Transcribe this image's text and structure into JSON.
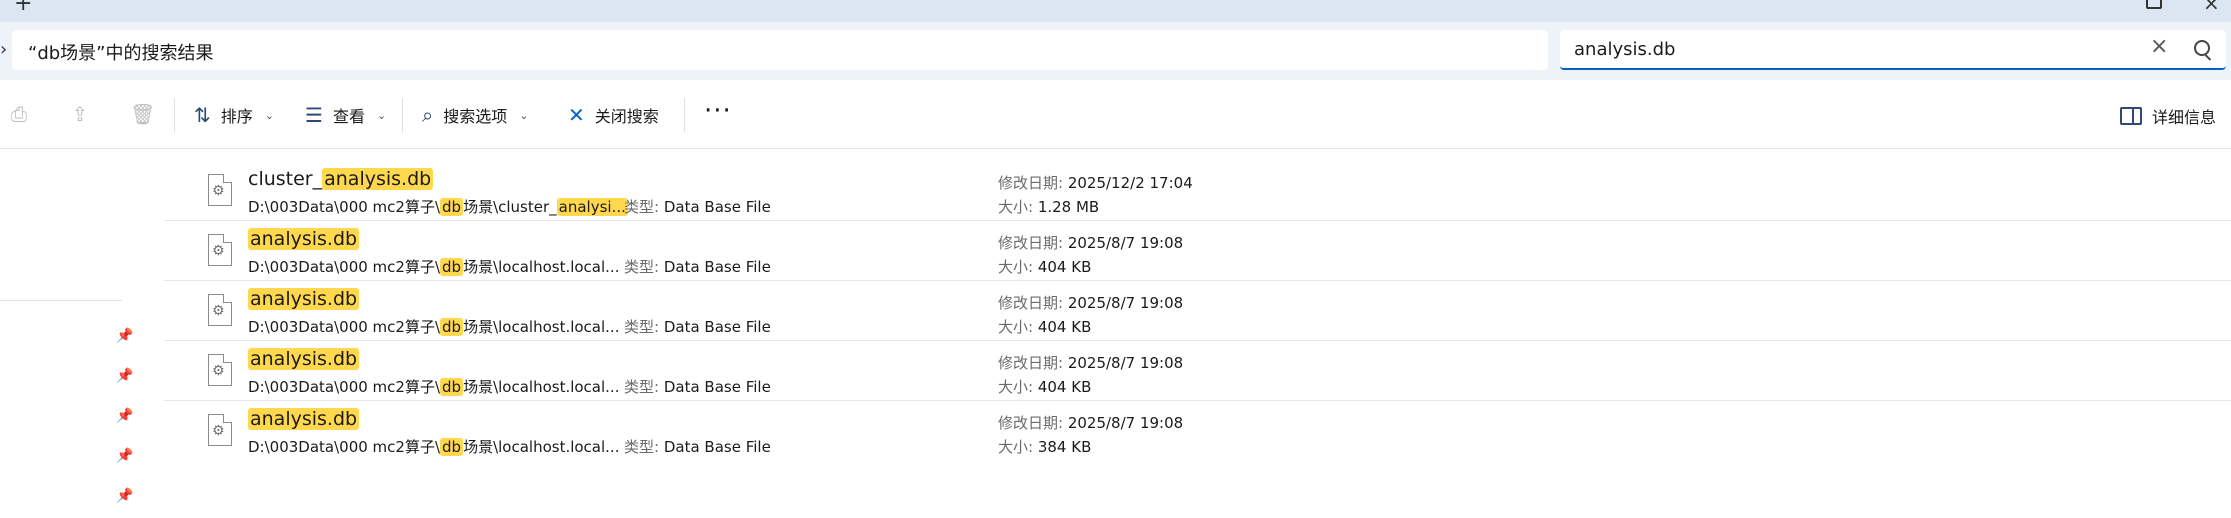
{
  "address": {
    "text": "“db场景”中的搜索结果"
  },
  "search": {
    "value": "analysis.db",
    "clear_icon": "close-icon",
    "search_icon": "search-icon"
  },
  "toolbar": {
    "sort_label": "排序",
    "view_label": "查看",
    "search_options_label": "搜索选项",
    "close_search_label": "关闭搜索",
    "more_label": "···",
    "details_label": "详细信息"
  },
  "labels": {
    "type_key": "类型: ",
    "date_key": "修改日期: ",
    "size_key": "大小: "
  },
  "results": [
    {
      "name_pre": "cluster_",
      "name_hl": "analysis.db",
      "path_pre": "D:\\003Data\\000 mc2算子\\",
      "path_hl": "db",
      "path_mid": "场景\\cluster_",
      "path_hl2": "analysi...",
      "type": "Data Base File",
      "date": "2025/12/2 17:04",
      "size": "1.28 MB"
    },
    {
      "name_pre": "",
      "name_hl": "analysis.db",
      "path_pre": "D:\\003Data\\000 mc2算子\\",
      "path_hl": "db",
      "path_mid": "场景\\localhost.local...",
      "path_hl2": "",
      "type": "Data Base File",
      "date": "2025/8/7 19:08",
      "size": "404 KB"
    },
    {
      "name_pre": "",
      "name_hl": "analysis.db",
      "path_pre": "D:\\003Data\\000 mc2算子\\",
      "path_hl": "db",
      "path_mid": "场景\\localhost.local...",
      "path_hl2": "",
      "type": "Data Base File",
      "date": "2025/8/7 19:08",
      "size": "404 KB"
    },
    {
      "name_pre": "",
      "name_hl": "analysis.db",
      "path_pre": "D:\\003Data\\000 mc2算子\\",
      "path_hl": "db",
      "path_mid": "场景\\localhost.local...",
      "path_hl2": "",
      "type": "Data Base File",
      "date": "2025/8/7 19:08",
      "size": "404 KB"
    },
    {
      "name_pre": "",
      "name_hl": "analysis.db",
      "path_pre": "D:\\003Data\\000 mc2算子\\",
      "path_hl": "db",
      "path_mid": "场景\\localhost.local...",
      "path_hl2": "",
      "type": "Data Base File",
      "date": "2025/8/7 19:08",
      "size": "384 KB"
    }
  ]
}
